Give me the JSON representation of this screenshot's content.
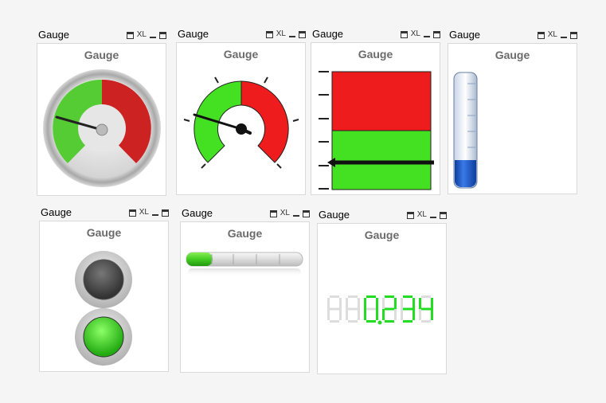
{
  "objects": [
    {
      "caption": "Gauge",
      "title": "Gauge",
      "xl": "XL"
    },
    {
      "caption": "Gauge",
      "title": "Gauge",
      "xl": "XL"
    },
    {
      "caption": "Gauge",
      "title": "Gauge",
      "xl": "XL"
    },
    {
      "caption": "Gauge",
      "title": "Gauge",
      "xl": "XL"
    },
    {
      "caption": "Gauge",
      "title": "Gauge",
      "xl": "XL"
    },
    {
      "caption": "Gauge",
      "title": "Gauge",
      "xl": "XL"
    },
    {
      "caption": "Gauge",
      "title": "Gauge",
      "xl": "XL"
    }
  ],
  "digital": {
    "ghost": "888888",
    "value": "0.234",
    "color": "#22dd22"
  },
  "colors": {
    "green": "#44e022",
    "red": "#ee1c1c",
    "blue": "#1a5fcc"
  }
}
